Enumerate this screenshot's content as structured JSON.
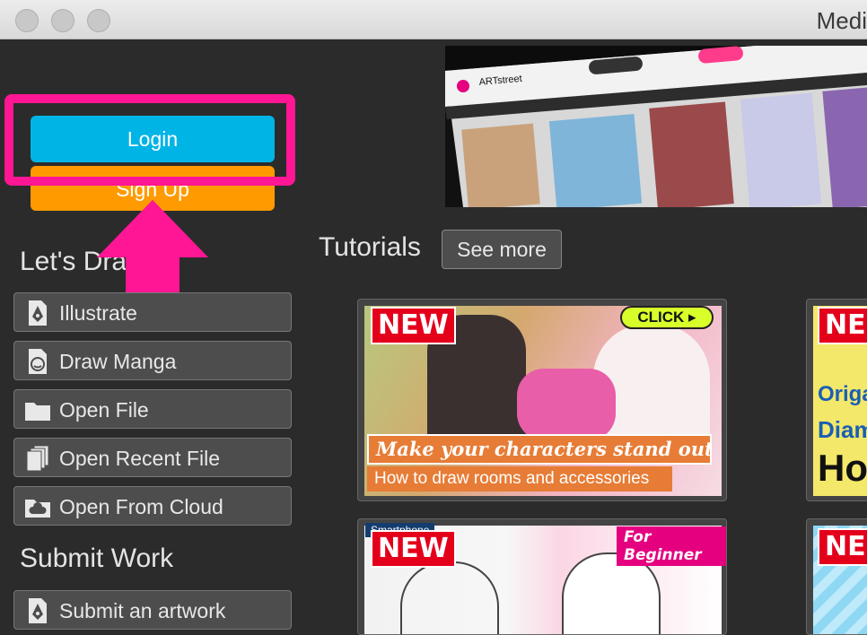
{
  "window": {
    "title": "Medi"
  },
  "auth": {
    "login_label": "Login",
    "signup_label": "Sign Up"
  },
  "lets_draw": {
    "heading": "Let's Draw",
    "items": [
      {
        "label": "Illustrate",
        "icon": "pen-nib-document-icon"
      },
      {
        "label": "Draw Manga",
        "icon": "manga-face-document-icon"
      },
      {
        "label": "Open File",
        "icon": "folder-icon"
      },
      {
        "label": "Open Recent File",
        "icon": "stacked-documents-icon"
      },
      {
        "label": "Open From Cloud",
        "icon": "cloud-folder-icon"
      }
    ]
  },
  "submit": {
    "heading": "Submit Work",
    "items": [
      {
        "label": "Submit an artwork",
        "icon": "pen-nib-document-icon"
      }
    ]
  },
  "tutorials": {
    "heading": "Tutorials",
    "see_more_label": "See more",
    "cards": [
      {
        "badge": "NEW",
        "click_label": "CLICK ▸",
        "headline": "Make your characters stand out!",
        "subline": "How to draw rooms and accessories"
      },
      {
        "badge": "NE",
        "partial_text_1": "Origa",
        "partial_text_2": "Diam",
        "partial_text_3": "Ho"
      },
      {
        "badge": "NEW",
        "corner_label": "For Beginner",
        "top_tag": "Smartphone"
      },
      {
        "badge": "NE"
      }
    ]
  },
  "banner": {
    "logo_text": "ARTstreet"
  },
  "colors": {
    "login": "#00b4e6",
    "signup": "#ff9a00",
    "highlight": "#ff1694",
    "new_badge": "#e4001b"
  }
}
